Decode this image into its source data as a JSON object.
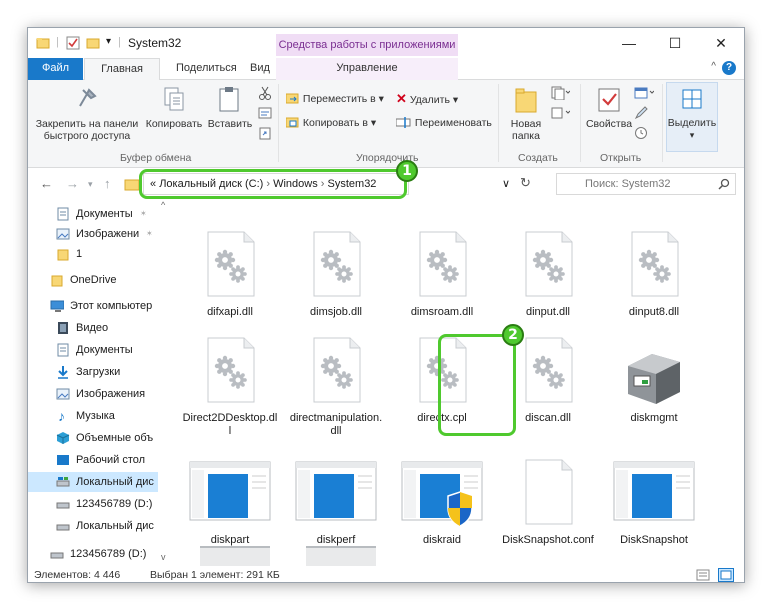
{
  "window": {
    "title": "System32",
    "contextual_tab_group": "Средства работы с приложениями",
    "controls": {
      "minimize": "—",
      "maximize": "☐",
      "close": "✕"
    }
  },
  "ribbon_tabs": {
    "file": "Файл",
    "home": "Главная",
    "share": "Поделиться",
    "view": "Вид",
    "manage": "Управление"
  },
  "ribbon": {
    "clipboard": {
      "pin_line1": "Закрепить на панели",
      "pin_line2": "быстрого доступа",
      "copy": "Копировать",
      "paste": "Вставить",
      "group_label": "Буфер обмена"
    },
    "organize": {
      "move_to": "Переместить в ▾",
      "copy_to": "Копировать в ▾",
      "delete": "Удалить ▾",
      "rename": "Переименовать",
      "group_label": "Упорядочить"
    },
    "new": {
      "new_folder_line1": "Новая",
      "new_folder_line2": "папка",
      "group_label": "Создать"
    },
    "open": {
      "properties": "Свойства",
      "group_label": "Открыть"
    },
    "select": {
      "select_label": "Выделить"
    }
  },
  "navigation": {
    "address": {
      "overflow": "«",
      "segments": [
        "Локальный диск (C:)",
        "Windows",
        "System32"
      ],
      "separator": "›"
    },
    "search_placeholder": "Поиск: System32",
    "dropdown": "∨",
    "refresh": "↻"
  },
  "annotations": {
    "step1": "1",
    "step2": "2"
  },
  "nav_pane": {
    "items": [
      {
        "label": "Документы",
        "pin": "📌",
        "icon": "documents-icon"
      },
      {
        "label": "Изображени",
        "pin": "📌",
        "icon": "pictures-icon"
      },
      {
        "label": "1",
        "icon": "folder-icon"
      },
      {
        "label": "OneDrive",
        "icon": "folder-icon"
      },
      {
        "label": "Этот компьютер",
        "icon": "computer-icon"
      },
      {
        "label": "Видео",
        "icon": "video-icon"
      },
      {
        "label": "Документы",
        "icon": "documents-icon"
      },
      {
        "label": "Загрузки",
        "icon": "downloads-icon"
      },
      {
        "label": "Изображения",
        "icon": "pictures-icon"
      },
      {
        "label": "Музыка",
        "icon": "music-icon"
      },
      {
        "label": "Объемные объ",
        "icon": "3d-objects-icon"
      },
      {
        "label": "Рабочий стол",
        "icon": "desktop-icon"
      },
      {
        "label": "Локальный дис",
        "icon": "drive-icon",
        "selected": true
      },
      {
        "label": "123456789 (D:)",
        "icon": "drive-icon"
      },
      {
        "label": "Локальный дис",
        "icon": "drive-icon"
      },
      {
        "label": "123456789 (D:)",
        "icon": "drive-icon"
      }
    ]
  },
  "files": [
    {
      "name": "difxapi.dll",
      "type": "dll"
    },
    {
      "name": "dimsjob.dll",
      "type": "dll"
    },
    {
      "name": "dimsroam.dll",
      "type": "dll"
    },
    {
      "name": "dinput.dll",
      "type": "dll"
    },
    {
      "name": "dinput8.dll",
      "type": "dll"
    },
    {
      "name": "Direct2DDesktop.dll",
      "type": "dll"
    },
    {
      "name": "directmanipulation.dll",
      "type": "dll"
    },
    {
      "name": "directx.cpl",
      "type": "dll",
      "highlighted": true
    },
    {
      "name": "discan.dll",
      "type": "dll"
    },
    {
      "name": "diskmgmt",
      "type": "msc"
    },
    {
      "name": "diskpart",
      "type": "exe"
    },
    {
      "name": "diskperf",
      "type": "exe"
    },
    {
      "name": "diskraid",
      "type": "exe-shield"
    },
    {
      "name": "DiskSnapshot.conf",
      "type": "blank"
    },
    {
      "name": "DiskSnapshot",
      "type": "exe"
    }
  ],
  "status": {
    "count": "Элементов: 4 446",
    "selection": "Выбран 1 элемент: 291 КБ"
  },
  "colors": {
    "accent": "#1979ca",
    "highlight": "#4fc92e",
    "context_tab": "#f0ddf5",
    "selected": "#cce8ff"
  }
}
